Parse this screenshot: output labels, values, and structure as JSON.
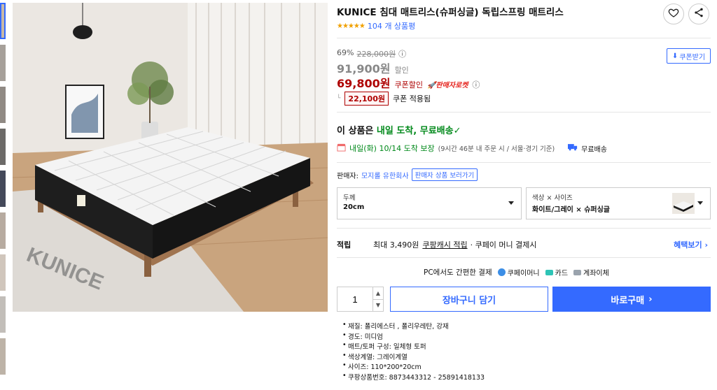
{
  "product": {
    "title": "KUNICE 침대 매트리스(슈퍼싱글) 독립스프링 매트리스",
    "stars": "★★★★★",
    "review_count": "104 개 상품평",
    "rating_out_of_5": 5
  },
  "pricing": {
    "discount_rate": "69%",
    "original_price": "228,000원",
    "sale_price": "91,900원",
    "sale_label": "할인",
    "coupon_price": "69,800원",
    "coupon_label": "쿠폰할인",
    "rocket_label": "판매자로켓",
    "coupon_button": "쿠폰받기",
    "cash_amount": "22,100원",
    "cash_label": "쿠폰 적용됨"
  },
  "delivery": {
    "title_prefix": "이 상품은",
    "title_highlight": "내일 도착, 무료배송",
    "arrival": "내일(화) 10/14 도착 보장",
    "condition": "(9시간 46분 내 주문 시 / 서울·경기 기준)",
    "free_shipping": "무료배송"
  },
  "seller": {
    "label": "판매자:",
    "name": "모지롤 유한회사",
    "button": "판매자 상품 보러가기"
  },
  "options": [
    {
      "label": "두께",
      "value": "20cm"
    },
    {
      "label": "색상 × 사이즈",
      "value": "화이트/그레이 × 슈퍼싱글"
    }
  ],
  "reward": {
    "label": "적립",
    "text_prefix": "최대 3,490원",
    "text_link": "쿠팡캐시 적립",
    "text_suffix": "· 쿠페이 머니 결제시",
    "more": "혜택보기"
  },
  "payment": {
    "title": "PC에서도 간편한 결제",
    "methods": [
      "쿠페이머니",
      "카드",
      "계좌이체"
    ]
  },
  "purchase": {
    "quantity": "1",
    "cart_button": "장바구니 담기",
    "buy_button": "바로구매"
  },
  "specs": [
    "재질: 폴리에스터 , 폴리우레탄, 강재",
    "경도: 미디엄",
    "매트/토퍼 구성: 일체형 토퍼",
    "색상계열: 그레이계열",
    "사이즈: 110*200*20cm",
    "쿠팡상품번호: 8873443312 - 25891418133"
  ],
  "image_watermark": "KUNICE",
  "colors": {
    "accent": "#346aff",
    "price_red": "#ae0000",
    "green": "#00891a"
  }
}
